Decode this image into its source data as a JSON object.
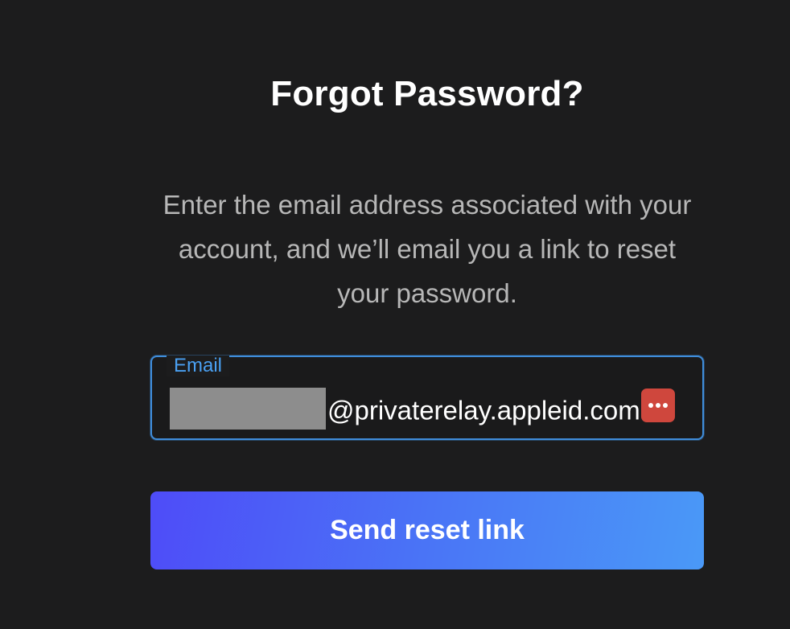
{
  "forgot_password": {
    "title": "Forgot Password?",
    "description": "Enter the email address associated with your account, and we’ll email you a link to reset your password.",
    "email_field": {
      "label": "Email",
      "value": "@privaterelay.appleid.com",
      "redacted": true
    },
    "send_button_label": "Send reset link"
  },
  "colors": {
    "background": "#1c1c1d",
    "accent": "#4aa0f2",
    "button_gradient_start": "#4e4cf8",
    "button_gradient_end": "#4a99f7",
    "autofill_badge": "#cf473d"
  },
  "icons": {
    "autofill": "more-dots-icon"
  }
}
